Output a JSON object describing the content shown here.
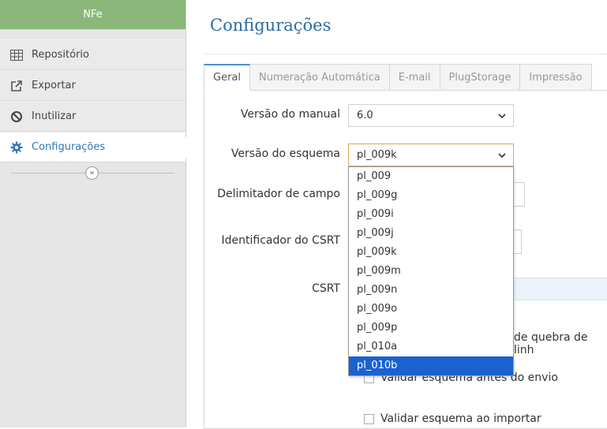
{
  "sidebar": {
    "header": "NFe",
    "items": [
      {
        "label": "Repositório",
        "icon": "table-icon"
      },
      {
        "label": "Exportar",
        "icon": "export-icon"
      },
      {
        "label": "Inutilizar",
        "icon": "ban-icon"
      },
      {
        "label": "Configurações",
        "icon": "gear-icon"
      }
    ],
    "active_index": 3,
    "collapse_icon": "«"
  },
  "main": {
    "title": "Configurações",
    "tabs": [
      "Geral",
      "Numeração Automática",
      "E-mail",
      "PlugStorage",
      "Impressão"
    ],
    "active_tab": 0
  },
  "form": {
    "manual_version_label": "Versão do manual",
    "manual_version_value": "6.0",
    "schema_version_label": "Versão do esquema",
    "schema_version_value": "pl_009k",
    "field_delimiter_label": "Delimitador de campo",
    "csrt_id_label": "Identificador do CSRT",
    "csrt_label": "CSRT",
    "line_break_text": "de quebra de linh",
    "validate_send_label": "Validar esquema antes do envio",
    "validate_import_label": "Validar esquema ao importar"
  },
  "dropdown": {
    "options": [
      "pl_009",
      "pl_009g",
      "pl_009i",
      "pl_009j",
      "pl_009k",
      "pl_009m",
      "pl_009n",
      "pl_009o",
      "pl_009p",
      "pl_010a",
      "pl_010b"
    ],
    "highlighted": "pl_010b"
  },
  "colors": {
    "header_green": "#8bb87a",
    "accent_blue": "#2b6ca3",
    "dropdown_highlight": "#1a62d0",
    "focus_orange": "#e2a35d",
    "csrt_bg": "#ebf2fb"
  }
}
